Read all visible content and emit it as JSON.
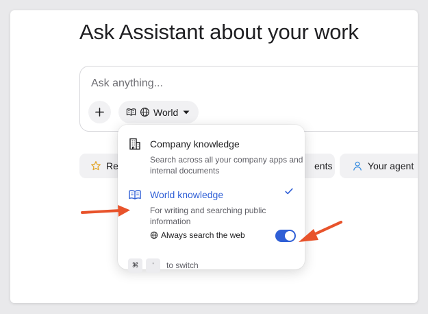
{
  "page": {
    "title": "Ask Assistant about your work"
  },
  "composer": {
    "placeholder": "Ask anything...",
    "add_icon": "plus-icon",
    "source_selector": {
      "label": "World",
      "icons": [
        "book-open-icon",
        "globe-icon",
        "caret-down-icon"
      ]
    }
  },
  "chips": [
    {
      "label": "Re",
      "icon": "star-icon"
    },
    {
      "label": "ents",
      "icon": ""
    },
    {
      "label": "Your agent",
      "icon": "user-icon"
    }
  ],
  "menu": {
    "options": [
      {
        "title": "Company knowledge",
        "description": "Search across all your company apps and internal documents",
        "icon": "building-icon",
        "selected": false
      },
      {
        "title": "World knowledge",
        "description": "For writing and searching public information",
        "icon": "book-open-icon",
        "selected": true
      }
    ],
    "web_search": {
      "label": "Always search the web",
      "icon": "globe-icon",
      "enabled": true
    },
    "shortcut": {
      "keys": [
        "⌘",
        "'"
      ],
      "text": "to switch"
    }
  },
  "colors": {
    "accent": "#2f5fd6",
    "annotation_arrow": "#e8532b",
    "chip_bg": "#f1f1f3",
    "star": "#e2a72e",
    "user_icon": "#3b8fe0"
  }
}
